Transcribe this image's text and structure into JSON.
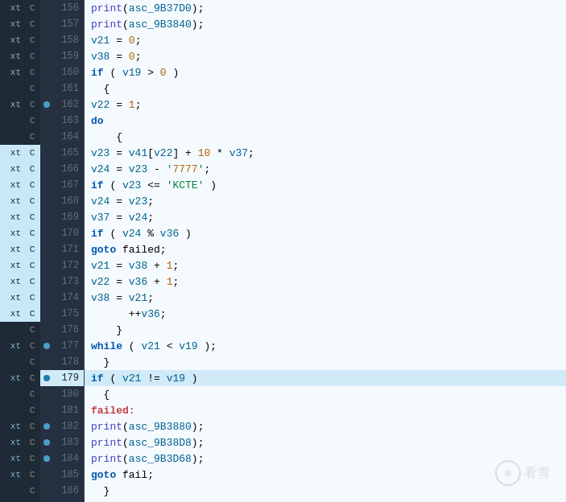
{
  "lines": [
    {
      "num": 156,
      "dot": false,
      "active": false,
      "highlight": false,
      "left": "xt",
      "second": "C",
      "code": "    print(asc_9B37D0);"
    },
    {
      "num": 157,
      "dot": false,
      "active": false,
      "highlight": false,
      "left": "xt",
      "second": "C",
      "code": "    print(asc_9B3840);"
    },
    {
      "num": 158,
      "dot": false,
      "active": false,
      "highlight": false,
      "left": "xt",
      "second": "C",
      "code": "  v21 = 0;"
    },
    {
      "num": 159,
      "dot": false,
      "active": false,
      "highlight": false,
      "left": "xt",
      "second": "C",
      "code": "  v38 = 0;"
    },
    {
      "num": 160,
      "dot": false,
      "active": false,
      "highlight": false,
      "left": "xt",
      "second": "C",
      "code": "  if ( v19 > 0 )"
    },
    {
      "num": 161,
      "dot": false,
      "active": false,
      "highlight": false,
      "left": "",
      "second": "C",
      "code": "  {"
    },
    {
      "num": 162,
      "dot": true,
      "active": false,
      "highlight": false,
      "left": "xt",
      "second": "C",
      "code": "    v22 = 1;"
    },
    {
      "num": 163,
      "dot": false,
      "active": false,
      "highlight": false,
      "left": "",
      "second": "C",
      "code": "    do"
    },
    {
      "num": 164,
      "dot": false,
      "active": false,
      "highlight": false,
      "left": "",
      "second": "C",
      "code": "    {"
    },
    {
      "num": 165,
      "dot": false,
      "active": false,
      "highlight": false,
      "left": "xt",
      "second": "C",
      "code": "      v23 = v41[v22] + 10 * v37;"
    },
    {
      "num": 166,
      "dot": false,
      "active": false,
      "highlight": false,
      "left": "xt",
      "second": "C",
      "code": "      v24 = v23 - '7777';"
    },
    {
      "num": 167,
      "dot": false,
      "active": false,
      "highlight": false,
      "left": "xt",
      "second": "C",
      "code": "      if ( v23 <= 'KCTE' )"
    },
    {
      "num": 168,
      "dot": false,
      "active": false,
      "highlight": false,
      "left": "xt",
      "second": "C",
      "code": "        v24 = v23;"
    },
    {
      "num": 169,
      "dot": false,
      "active": false,
      "highlight": false,
      "left": "xt",
      "second": "C",
      "code": "      v37 = v24;"
    },
    {
      "num": 170,
      "dot": false,
      "active": false,
      "highlight": false,
      "left": "xt",
      "second": "C",
      "code": "      if ( v24 % v36 )"
    },
    {
      "num": 171,
      "dot": false,
      "active": false,
      "highlight": false,
      "left": "xt",
      "second": "C",
      "code": "        goto failed;"
    },
    {
      "num": 172,
      "dot": false,
      "active": false,
      "highlight": false,
      "left": "xt",
      "second": "C",
      "code": "      v21 = v38 + 1;"
    },
    {
      "num": 173,
      "dot": false,
      "active": false,
      "highlight": false,
      "left": "xt",
      "second": "C",
      "code": "      v22 = v36 + 1;"
    },
    {
      "num": 174,
      "dot": false,
      "active": false,
      "highlight": false,
      "left": "xt",
      "second": "C",
      "code": "      v38 = v21;"
    },
    {
      "num": 175,
      "dot": false,
      "active": false,
      "highlight": false,
      "left": "xt",
      "second": "C",
      "code": "      ++v36;"
    },
    {
      "num": 176,
      "dot": false,
      "active": false,
      "highlight": false,
      "left": "",
      "second": "C",
      "code": "    }"
    },
    {
      "num": 177,
      "dot": true,
      "active": false,
      "highlight": false,
      "left": "xt",
      "second": "C",
      "code": "    while ( v21 < v19 );"
    },
    {
      "num": 178,
      "dot": false,
      "active": false,
      "highlight": false,
      "left": "",
      "second": "C",
      "code": "  }"
    },
    {
      "num": 179,
      "dot": true,
      "active": true,
      "highlight": false,
      "left": "xt",
      "second": "C",
      "code": "  if ( v21 != v19 )"
    },
    {
      "num": 180,
      "dot": false,
      "active": false,
      "highlight": false,
      "left": "",
      "second": "C",
      "code": "  {"
    },
    {
      "num": 181,
      "dot": false,
      "active": false,
      "highlight": false,
      "left": "",
      "second": "C",
      "code": "failed:"
    },
    {
      "num": 182,
      "dot": true,
      "active": false,
      "highlight": false,
      "left": "xt",
      "second": "C",
      "code": "    print(asc_9B3880);"
    },
    {
      "num": 183,
      "dot": true,
      "active": false,
      "highlight": false,
      "left": "xt",
      "second": "C",
      "code": "    print(asc_9B38D8);"
    },
    {
      "num": 184,
      "dot": true,
      "active": false,
      "highlight": false,
      "left": "xt",
      "second": "C",
      "code": "    print(asc_9B3D68);"
    },
    {
      "num": 185,
      "dot": false,
      "active": false,
      "highlight": false,
      "left": "xt",
      "second": "C",
      "code": "    goto fail;"
    },
    {
      "num": 186,
      "dot": false,
      "active": false,
      "highlight": false,
      "left": "",
      "second": "C",
      "code": "  }"
    }
  ],
  "highlight_rows": [
    156,
    157,
    158,
    159,
    160,
    162,
    165,
    166,
    167,
    168,
    169,
    170,
    171,
    172,
    173,
    174,
    175,
    177,
    179,
    182,
    183,
    184,
    185
  ],
  "left_highlight_rows": [
    165,
    166,
    167,
    168,
    169,
    170,
    171,
    172,
    173,
    174,
    175
  ],
  "accent_color": "#4a9ec8"
}
